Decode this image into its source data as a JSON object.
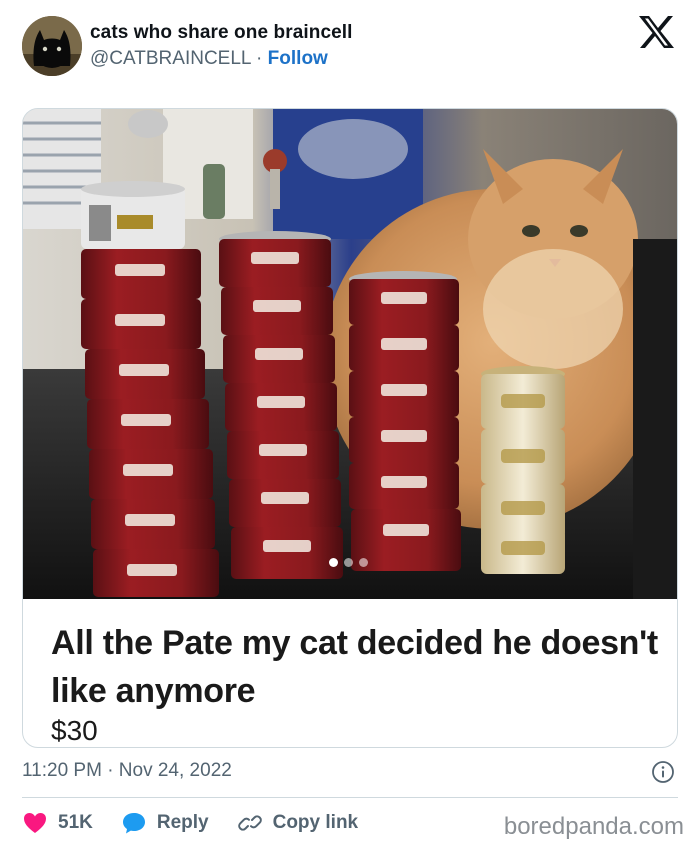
{
  "author": {
    "name": "cats who share one braincell",
    "handle": "@CATBRAINCELL",
    "separator": " · ",
    "follow_label": "Follow",
    "avatar_icon": "cat-avatar-icon"
  },
  "platform_icon": "x-logo-icon",
  "post": {
    "caption": "All the Pate my cat decided he doesn't like anymore",
    "price": "$30",
    "media_description_icon": "photo-cat-food-cans",
    "pager": {
      "count": 3,
      "active_index": 0
    }
  },
  "meta": {
    "timestamp": "11:20 PM · Nov 24, 2022",
    "info_icon": "info-icon"
  },
  "actions": {
    "like_count": "51K",
    "reply_label": "Reply",
    "copy_link_label": "Copy link"
  },
  "watermark": "boredpanda.com",
  "colors": {
    "accent": "#1d72c8",
    "like": "#f91880",
    "reply": "#1d9bf0",
    "secondary_text": "#536471",
    "border": "#cfd9de"
  }
}
